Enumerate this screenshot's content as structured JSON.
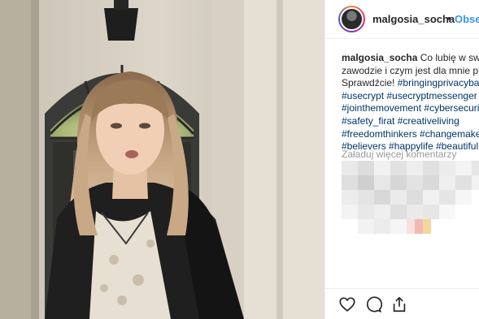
{
  "post": {
    "username": "malgosia_socha",
    "follow_label": "Obserwuj",
    "separator": "•",
    "caption": {
      "username": "malgosia_socha",
      "text_line1": "Co lubię w swoim",
      "text_line2": "zawodzie i czym jest dla mnie pr",
      "text_line3": "Sprawdźcie!",
      "hashtags": [
        "#bringingprivacyback",
        "#usecrypt #usecryptmessenger",
        "#jointhemovement #cybersecurity",
        "#safety_firat #creativeliving",
        "#freedomthinkers #changemakers",
        "#believers #happylife #beautiful"
      ]
    },
    "load_more_label": "Załaduj więcej komentarzy"
  },
  "icons": {
    "like": "heart-icon",
    "comment": "comment-icon",
    "share": "share-icon"
  },
  "colors": {
    "link": "#003569",
    "follow": "#3897f0",
    "muted": "#999999"
  }
}
